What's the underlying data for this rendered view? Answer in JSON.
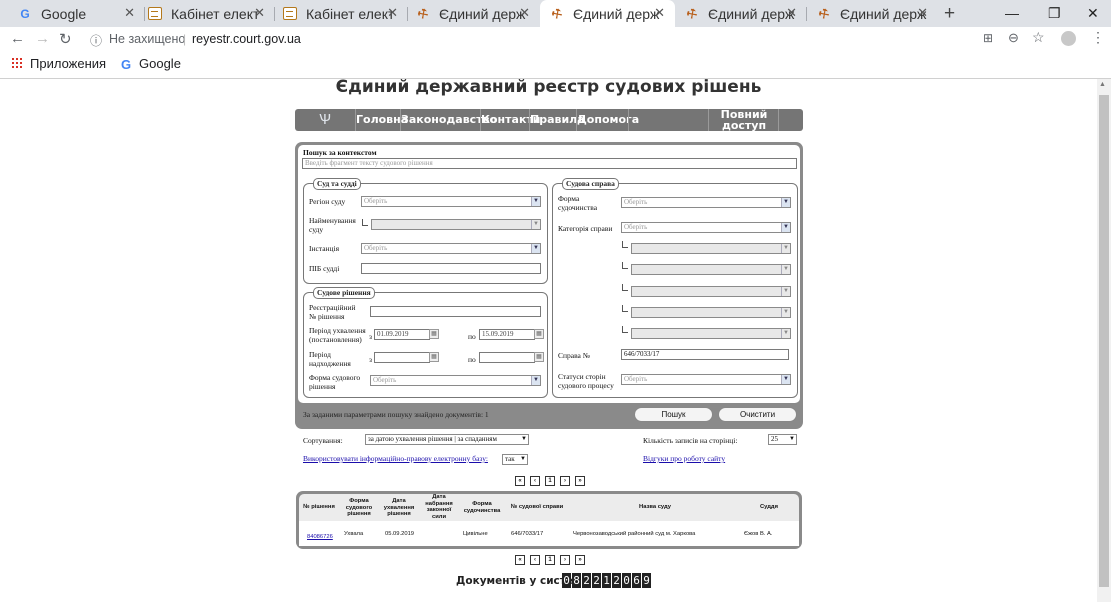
{
  "browser": {
    "tabs": [
      {
        "title": "Google",
        "icon": "google-icon"
      },
      {
        "title": "Кабінет електр",
        "icon": "cabinet-icon"
      },
      {
        "title": "Кабінет електр",
        "icon": "cabinet-icon"
      },
      {
        "title": "Єдиний держ",
        "icon": "gavel-icon"
      },
      {
        "title": "Єдиний держ",
        "icon": "gavel-icon",
        "active": true
      },
      {
        "title": "Єдиний держ",
        "icon": "gavel-icon"
      },
      {
        "title": "Єдиний держ",
        "icon": "gavel-icon"
      }
    ],
    "security_label": "Не захищено",
    "url": "reyestr.court.gov.ua",
    "bookmarks": {
      "apps": "Приложения",
      "google": "Google"
    }
  },
  "page": {
    "title": "Єдиний державний реєстр судових рішень",
    "menu": [
      "Головна",
      "Законодавство",
      "Контакти",
      "Правила",
      "Допомога"
    ],
    "full_access_line1": "Повний",
    "full_access_line2": "доступ"
  },
  "form": {
    "context_label": "Пошук за контекстом",
    "context_placeholder": "Введіть фрагмент тексту судового рішення",
    "court_group": "Суд та судді",
    "region_label": "Регіон суду",
    "court_name_label_1": "Найменування",
    "court_name_label_2": "суду",
    "instance_label": "Інстанція",
    "judge_label": "ПІБ судді",
    "choose": "Оберіть",
    "decision_group": "Судове рішення",
    "reg_no_label_1": "Реєстраційний",
    "reg_no_label_2": "№ рішення",
    "period_adopt_1": "Період ухвалення",
    "period_adopt_2": "(постановлення)",
    "from": "з",
    "to": "по",
    "date_from": "01.09.2019",
    "date_to": "15.09.2019",
    "period_receive_1": "Період",
    "period_receive_2": "надходження",
    "decision_form_1": "Форма судового",
    "decision_form_2": "рішення",
    "case_group": "Судова справа",
    "proc_form_1": "Форма",
    "proc_form_2": "судочинства",
    "category_label": "Категорія справи",
    "case_no_label": "Справа №",
    "case_no_value": "646/7033/17",
    "party_status_1": "Статуси сторін",
    "party_status_2": "судового процесу",
    "found_text": "За заданими параметрами пошуку знайдено документів: 1",
    "search_button": "Пошук",
    "clear_button": "Очистити"
  },
  "options": {
    "sort_label": "Сортування:",
    "sort_value": "за датою ухвалення рішення | за спаданням",
    "per_page_label": "Кількість записів на сторінці:",
    "per_page_value": "25",
    "ils_link": "Використовувати інформаційно-правову електронну базу:",
    "ils_value": "так",
    "feedback_link": "Відгуки про роботу сайту"
  },
  "pagination": {
    "first": "«",
    "prev": "‹",
    "current": "1",
    "next": "›",
    "last": "»"
  },
  "results": {
    "headers": {
      "no": "№ рішення",
      "form_1": "Форма",
      "form_2": "судового",
      "form_3": "рішення",
      "date_1": "Дата",
      "date_2": "ухвалення",
      "date_3": "рішення",
      "force_1": "Дата",
      "force_2": "набрання",
      "force_3": "законної",
      "force_4": "сили",
      "proc_1": "Форма",
      "proc_2": "судочинства",
      "case": "№ судової справи",
      "court": "Назва суду",
      "judge": "Суддя"
    },
    "rows": [
      {
        "no": "84086726",
        "form": "Ухвала",
        "date": "05.09.2019",
        "force": "",
        "proc": "Цивільне",
        "case": "646/7033/17",
        "court": "Червонозаводський районний суд м. Харкова",
        "judge": "Єжов В. А."
      }
    ]
  },
  "footer": {
    "docs_label": "Документів у системі:",
    "docs_count": "082212069"
  }
}
